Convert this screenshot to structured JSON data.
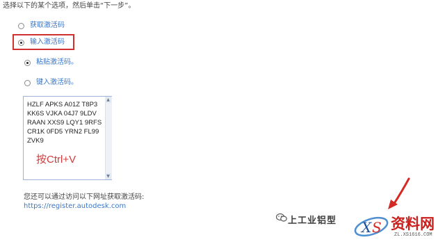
{
  "instruction": "选择以下的某个选项，然后单击“下一步”。",
  "options": {
    "get_code": {
      "label": "获取激活码",
      "checked": false
    },
    "enter_code": {
      "label": "输入激活码",
      "checked": true
    }
  },
  "sub_options": {
    "paste": {
      "label": "粘贴激活码。",
      "checked": true
    },
    "type": {
      "label": "键入激活码。",
      "checked": false
    }
  },
  "activation_code": {
    "lines": [
      "HZLF APKS A01Z T8P3",
      "KK6S VJKA 04J7 9LDV",
      "RAAN XXS9 LQY1 9RFS",
      "CR1K 0FD5 YRN2 FL99",
      "ZVK9"
    ]
  },
  "hint": "按Ctrl+V",
  "footer": {
    "note": "您还可以通过访问以下网址获取激活码:",
    "url": "https://register.autodesk.com"
  },
  "watermark": {
    "name": "上工业铝型",
    "brand": "资料网",
    "brand_url": "ZL.XS1616.COM"
  },
  "colors": {
    "highlight": "#d13030",
    "link": "#3a77c8",
    "hint": "#d63b3b",
    "arrow": "#d42a26"
  }
}
